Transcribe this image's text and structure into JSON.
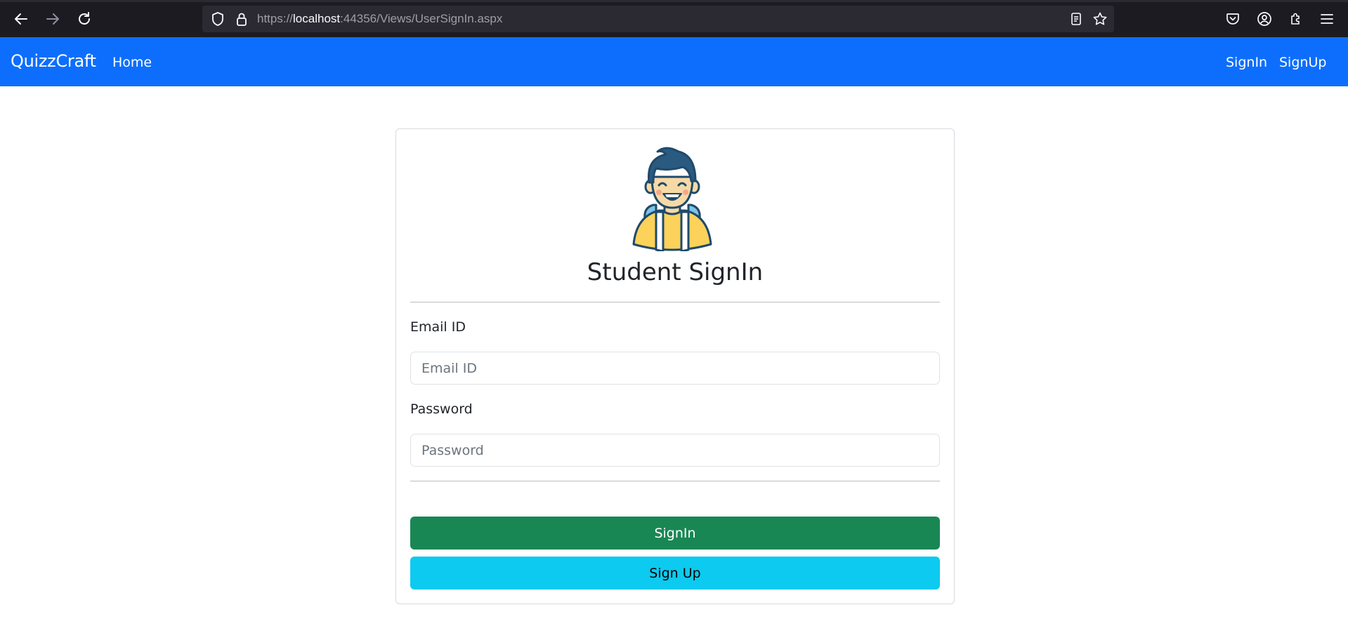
{
  "browser": {
    "url_prefix": "https://",
    "url_host": "localhost",
    "url_rest": ":44356/Views/UserSignIn.aspx",
    "icons": [
      "back-icon",
      "forward-icon",
      "reload-icon",
      "shield-icon",
      "lock-icon",
      "reader-view-icon",
      "bookmark-star-icon",
      "pocket-icon",
      "account-icon",
      "extensions-icon",
      "menu-icon"
    ]
  },
  "navbar": {
    "brand": "QuizzCraft",
    "home": "Home",
    "signin": "SignIn",
    "signup": "SignUp",
    "color": "#0d6efd"
  },
  "card": {
    "title": "Student SignIn",
    "email_label": "Email ID",
    "email_placeholder": "Email ID",
    "email_value": "",
    "password_label": "Password",
    "password_placeholder": "Password",
    "password_value": "",
    "signin_button": "SignIn",
    "signup_button": "Sign Up",
    "signin_color": "#198754",
    "signup_color": "#0dcaf0"
  }
}
